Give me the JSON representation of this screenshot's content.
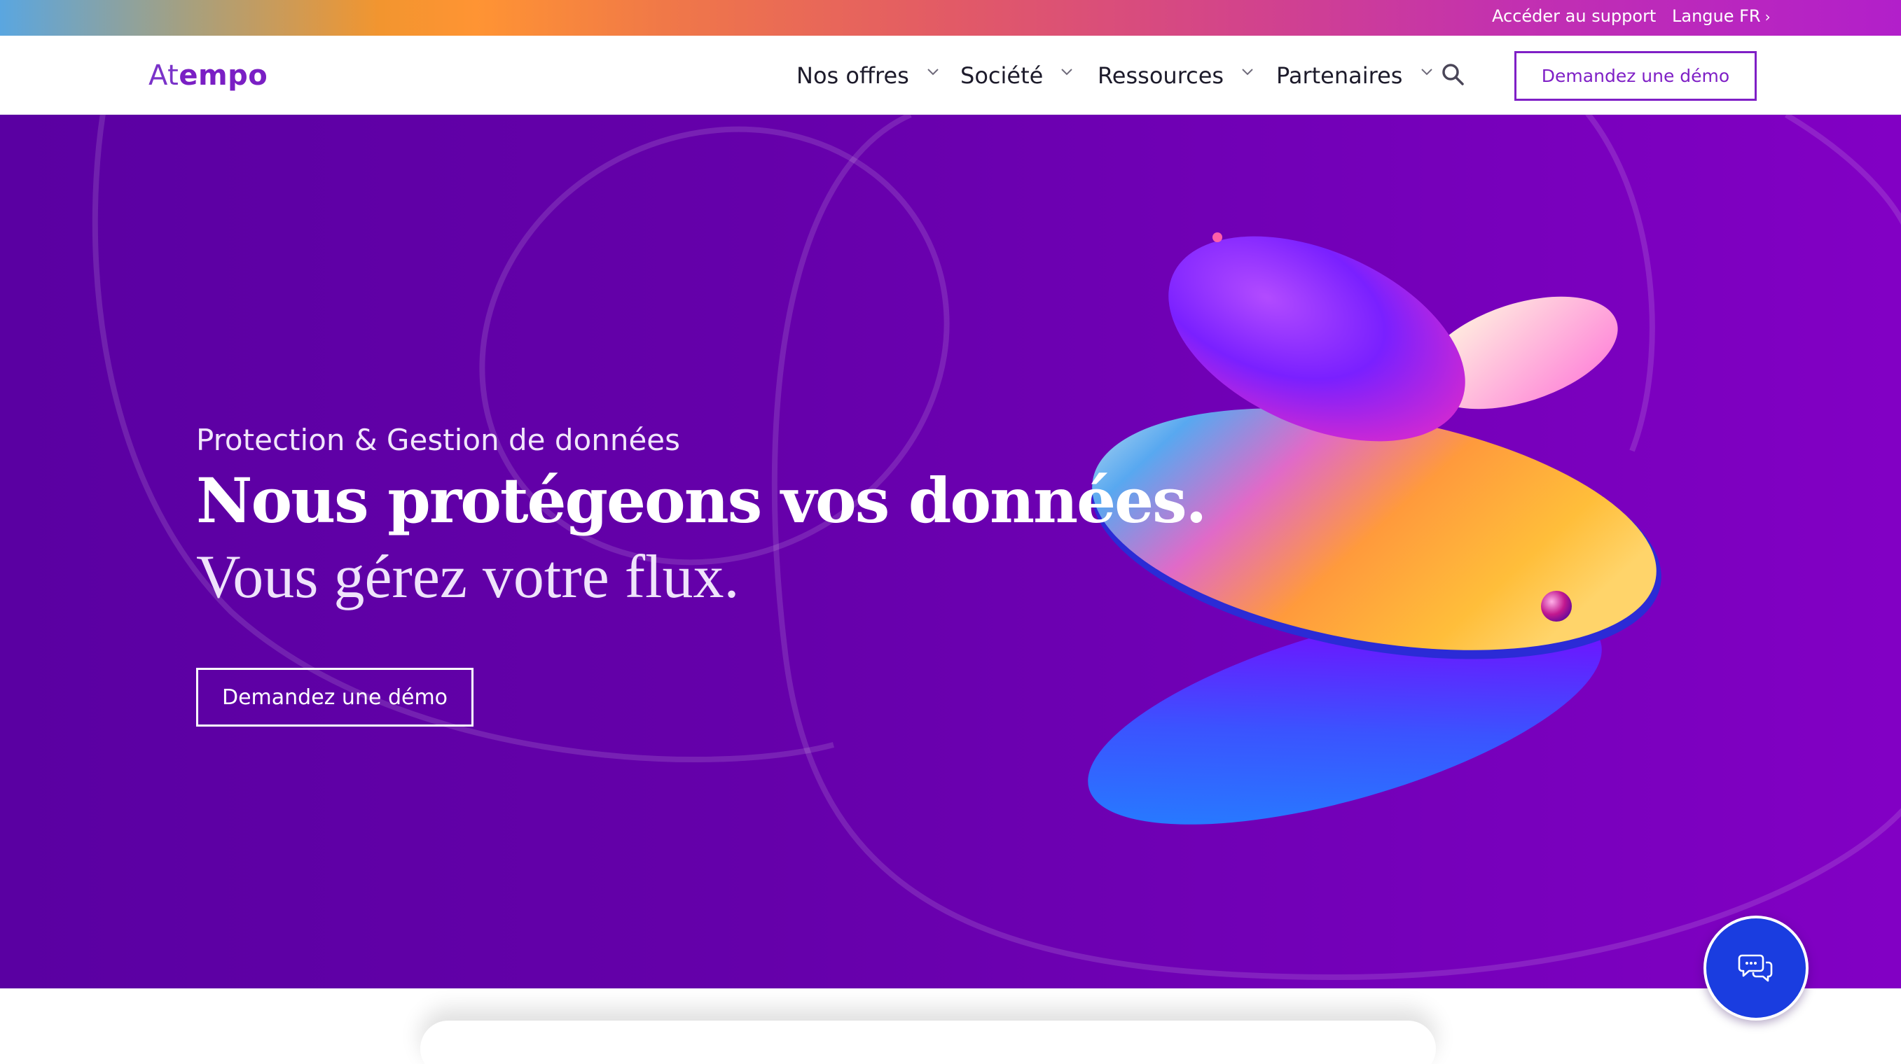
{
  "topbar": {
    "support": "Accéder au support",
    "langue": "Langue FR",
    "langue_chevron": "›"
  },
  "header": {
    "logo_a": "At",
    "logo_b": "empo",
    "nav": [
      {
        "label": "Nos offres",
        "icon": "chevron-down-icon"
      },
      {
        "label": "Société",
        "icon": "chevron-down-icon"
      },
      {
        "label": "Ressources",
        "icon": "chevron-down-icon"
      },
      {
        "label": "Partenaires",
        "icon": "chevron-down-icon"
      }
    ],
    "search_icon": "search-icon",
    "demo_button": "Demandez une démo"
  },
  "hero": {
    "subtitle": "Protection & Gestion de données",
    "title": "Nous protégeons vos données.",
    "title_line2": "Vous gérez votre flux.",
    "cta": "Demandez une démo"
  },
  "chat": {
    "icon": "chat-bubbles-icon"
  },
  "colors": {
    "brand_purple": "#7f1fc6",
    "hero_bg": "#6500aa",
    "chat_blue": "#1a3de0"
  }
}
